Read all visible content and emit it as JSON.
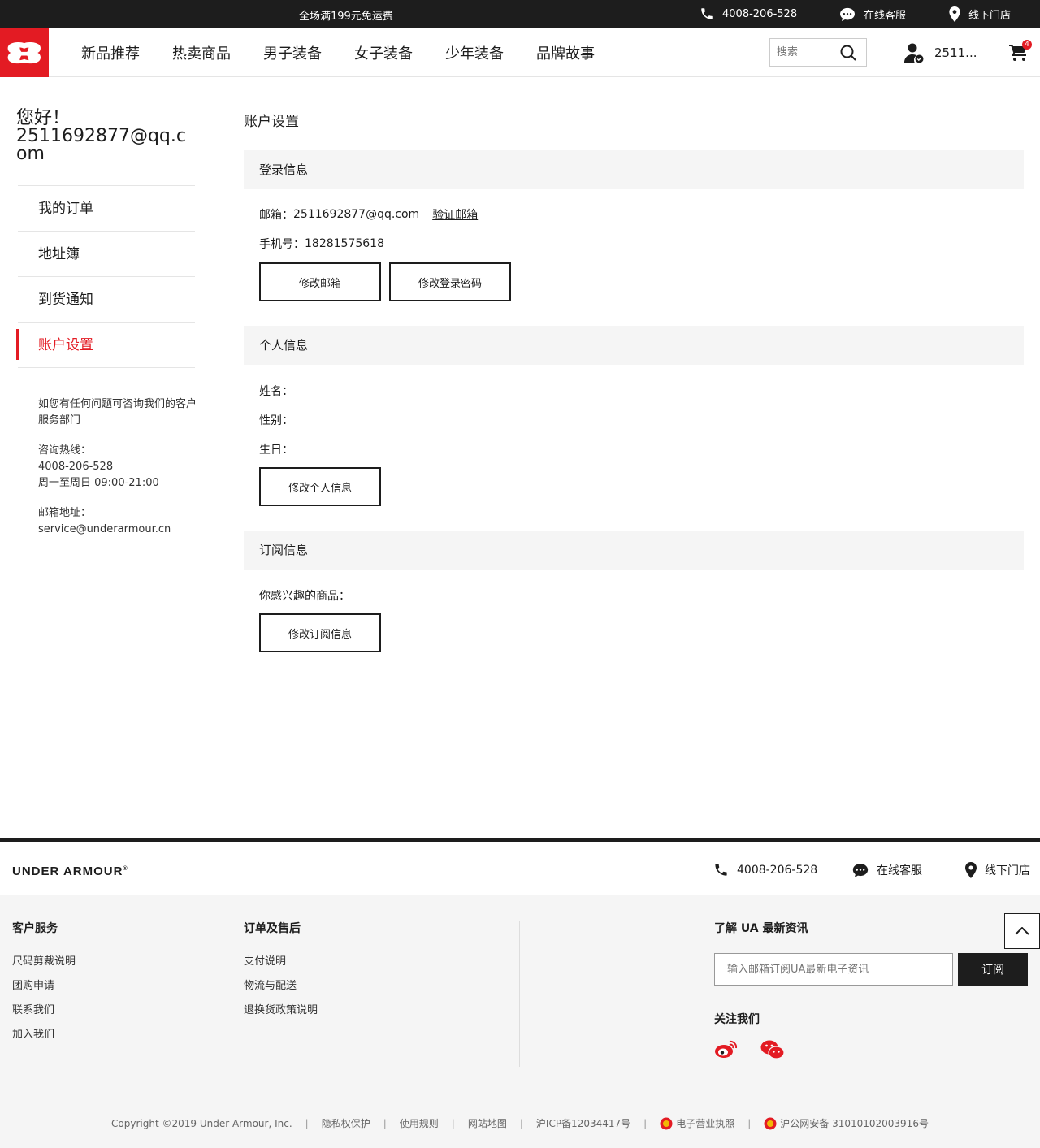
{
  "topbar": {
    "promo": "全场满199元免运费",
    "phone": "4008-206-528",
    "online_service": "在线客服",
    "stores": "线下门店"
  },
  "nav": {
    "items": [
      "新品推荐",
      "热卖商品",
      "男子装备",
      "女子装备",
      "少年装备",
      "品牌故事"
    ],
    "search_placeholder": "搜索",
    "user_name": "2511...",
    "cart_count": "4"
  },
  "sidebar": {
    "greeting": "您好！",
    "email": "2511692877@qq.com",
    "menu": [
      "我的订单",
      "地址簿",
      "到货通知",
      "账户设置"
    ],
    "active": "账户设置",
    "help_text": "如您有任何问题可咨询我们的客户服务部门",
    "hotline_label": "咨询热线：",
    "hotline": "4008-206-528",
    "hours": "周一至周日 09:00-21:00",
    "mail_label": "邮箱地址：",
    "mail": "service@underarmour.cn"
  },
  "main": {
    "title": "账户设置",
    "login": {
      "heading": "登录信息",
      "email_label": "邮箱：",
      "email": "2511692877@qq.com",
      "verify": "验证邮箱",
      "phone_label": "手机号：",
      "phone": "18281575618",
      "btn_email": "修改邮箱",
      "btn_password": "修改登录密码"
    },
    "personal": {
      "heading": "个人信息",
      "name_label": "姓名：",
      "gender_label": "性别：",
      "birthday_label": "生日：",
      "btn": "修改个人信息"
    },
    "subscribe": {
      "heading": "订阅信息",
      "interest_label": "你感兴趣的商品：",
      "btn": "修改订阅信息"
    }
  },
  "footer": {
    "logo": "UNDER ARMOUR",
    "phone": "4008-206-528",
    "online_service": "在线客服",
    "stores": "线下门店",
    "col1": {
      "title": "客户服务",
      "links": [
        "尺码剪裁说明",
        "团购申请",
        "联系我们",
        "加入我们"
      ]
    },
    "col2": {
      "title": "订单及售后",
      "links": [
        "支付说明",
        "物流与配送",
        "退换货政策说明"
      ]
    },
    "news_title": "了解 UA 最新资讯",
    "news_placeholder": "输入邮箱订阅UA最新电子资讯",
    "subscribe_btn": "订阅",
    "follow": "关注我们",
    "copyright": "Copyright ©2019 Under Armour, Inc.",
    "links": [
      "隐私权保护",
      "使用规则",
      "网站地图",
      "沪ICP备12034417号",
      "电子营业执照",
      "沪公网安备 31010102003916号"
    ]
  },
  "colors": {
    "brand": "#e31b23",
    "dark": "#1d1d1d",
    "panel": "#f5f5f5"
  }
}
